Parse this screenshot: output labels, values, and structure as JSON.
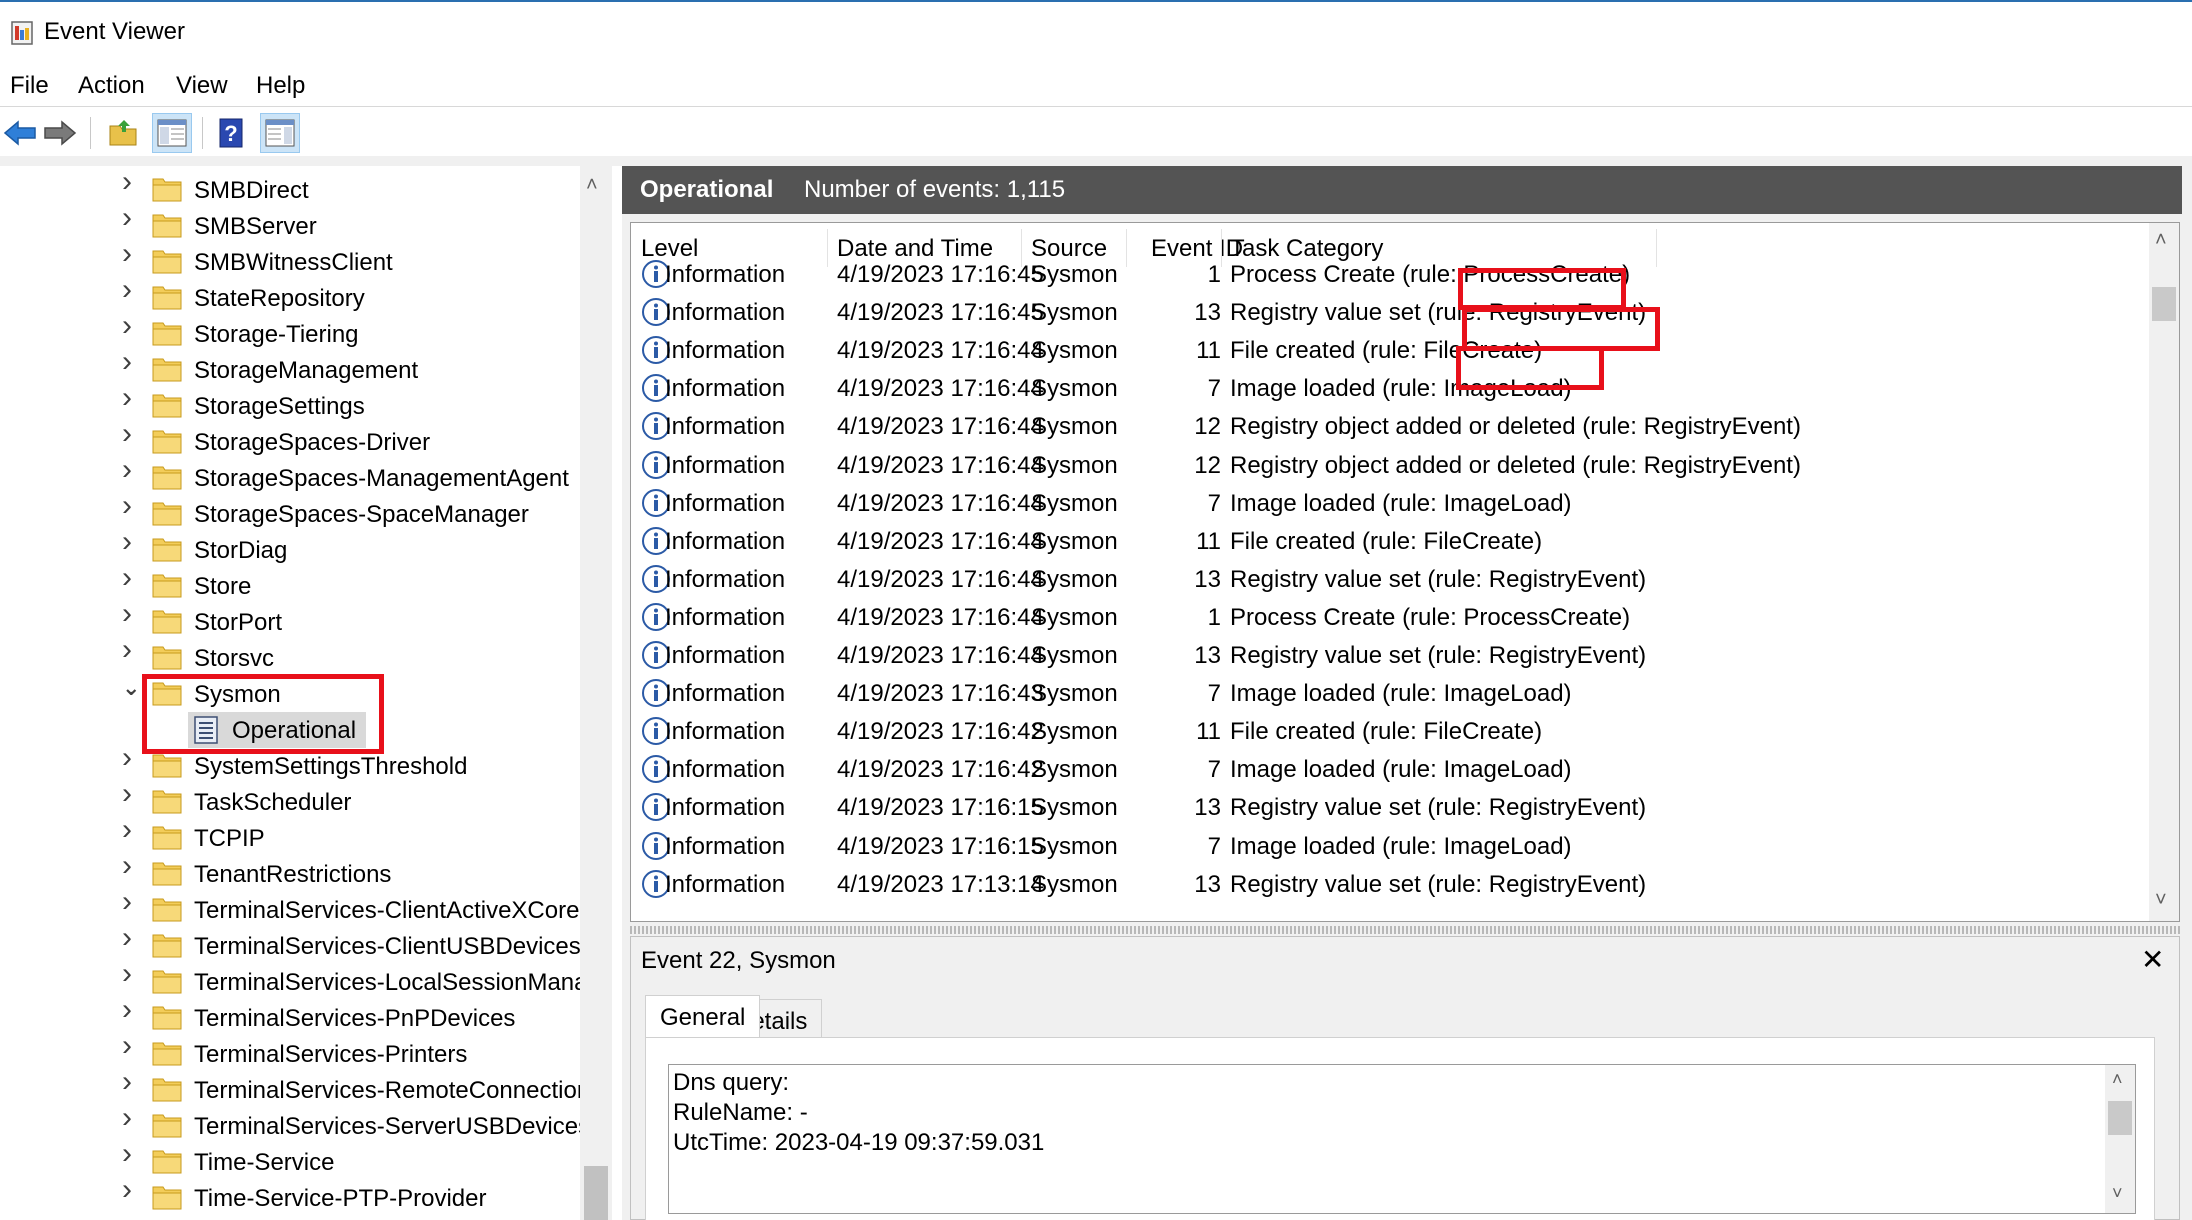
{
  "window": {
    "title": "Event Viewer"
  },
  "menu": [
    "File",
    "Action",
    "View",
    "Help"
  ],
  "toolbar": {
    "icons": [
      "back-arrow-icon",
      "forward-arrow-icon",
      "open-folder-icon",
      "show-hide-console-tree-icon",
      "help-icon",
      "show-hide-action-pane-icon"
    ]
  },
  "tree": {
    "items": [
      {
        "label": "SMBDirect",
        "expanded": false
      },
      {
        "label": "SMBServer",
        "expanded": false
      },
      {
        "label": "SMBWitnessClient",
        "expanded": false
      },
      {
        "label": "StateRepository",
        "expanded": false
      },
      {
        "label": "Storage-Tiering",
        "expanded": false
      },
      {
        "label": "StorageManagement",
        "expanded": false
      },
      {
        "label": "StorageSettings",
        "expanded": false
      },
      {
        "label": "StorageSpaces-Driver",
        "expanded": false
      },
      {
        "label": "StorageSpaces-ManagementAgent",
        "expanded": false
      },
      {
        "label": "StorageSpaces-SpaceManager",
        "expanded": false
      },
      {
        "label": "StorDiag",
        "expanded": false
      },
      {
        "label": "Store",
        "expanded": false
      },
      {
        "label": "StorPort",
        "expanded": false
      },
      {
        "label": "Storsvc",
        "expanded": false
      },
      {
        "label": "Sysmon",
        "expanded": true
      },
      {
        "label": "Operational",
        "child": true,
        "selected": true
      },
      {
        "label": "SystemSettingsThreshold",
        "expanded": false
      },
      {
        "label": "TaskScheduler",
        "expanded": false
      },
      {
        "label": "TCPIP",
        "expanded": false
      },
      {
        "label": "TenantRestrictions",
        "expanded": false
      },
      {
        "label": "TerminalServices-ClientActiveXCore",
        "expanded": false
      },
      {
        "label": "TerminalServices-ClientUSBDevices",
        "expanded": false
      },
      {
        "label": "TerminalServices-LocalSessionManag",
        "expanded": false
      },
      {
        "label": "TerminalServices-PnPDevices",
        "expanded": false
      },
      {
        "label": "TerminalServices-Printers",
        "expanded": false
      },
      {
        "label": "TerminalServices-RemoteConnectionI",
        "expanded": false
      },
      {
        "label": "TerminalServices-ServerUSBDevices",
        "expanded": false
      },
      {
        "label": "Time-Service",
        "expanded": false
      },
      {
        "label": "Time-Service-PTP-Provider",
        "expanded": false
      }
    ]
  },
  "log": {
    "title": "Operational",
    "count_text": "Number of events: 1,115",
    "columns": [
      "Level",
      "Date and Time",
      "Source",
      "Event ID",
      "Task Category"
    ],
    "rows": [
      [
        "Information",
        "4/19/2023 17:16:45",
        "Sysmon",
        "1",
        "Process Create (rule: ProcessCreate)"
      ],
      [
        "Information",
        "4/19/2023 17:16:45",
        "Sysmon",
        "13",
        "Registry value set (rule: RegistryEvent)"
      ],
      [
        "Information",
        "4/19/2023 17:16:44",
        "Sysmon",
        "11",
        "File created (rule: FileCreate)"
      ],
      [
        "Information",
        "4/19/2023 17:16:44",
        "Sysmon",
        "7",
        "Image loaded (rule: ImageLoad)"
      ],
      [
        "Information",
        "4/19/2023 17:16:44",
        "Sysmon",
        "12",
        "Registry object added or deleted (rule: RegistryEvent)"
      ],
      [
        "Information",
        "4/19/2023 17:16:44",
        "Sysmon",
        "12",
        "Registry object added or deleted (rule: RegistryEvent)"
      ],
      [
        "Information",
        "4/19/2023 17:16:44",
        "Sysmon",
        "7",
        "Image loaded (rule: ImageLoad)"
      ],
      [
        "Information",
        "4/19/2023 17:16:44",
        "Sysmon",
        "11",
        "File created (rule: FileCreate)"
      ],
      [
        "Information",
        "4/19/2023 17:16:44",
        "Sysmon",
        "13",
        "Registry value set (rule: RegistryEvent)"
      ],
      [
        "Information",
        "4/19/2023 17:16:44",
        "Sysmon",
        "1",
        "Process Create (rule: ProcessCreate)"
      ],
      [
        "Information",
        "4/19/2023 17:16:44",
        "Sysmon",
        "13",
        "Registry value set (rule: RegistryEvent)"
      ],
      [
        "Information",
        "4/19/2023 17:16:43",
        "Sysmon",
        "7",
        "Image loaded (rule: ImageLoad)"
      ],
      [
        "Information",
        "4/19/2023 17:16:42",
        "Sysmon",
        "11",
        "File created (rule: FileCreate)"
      ],
      [
        "Information",
        "4/19/2023 17:16:42",
        "Sysmon",
        "7",
        "Image loaded (rule: ImageLoad)"
      ],
      [
        "Information",
        "4/19/2023 17:16:15",
        "Sysmon",
        "13",
        "Registry value set (rule: RegistryEvent)"
      ],
      [
        "Information",
        "4/19/2023 17:16:15",
        "Sysmon",
        "7",
        "Image loaded (rule: ImageLoad)"
      ],
      [
        "Information",
        "4/19/2023 17:13:14",
        "Sysmon",
        "13",
        "Registry value set (rule: RegistryEvent)"
      ]
    ]
  },
  "detail": {
    "title": "Event 22, Sysmon",
    "close": "✕",
    "tabs": [
      "General",
      "Details"
    ],
    "lines": [
      "Dns query:",
      "RuleName: -",
      "UtcTime: 2023-04-19 09:37:59.031"
    ]
  },
  "colors": {
    "highlight_box": "#e8101a",
    "header_bg": "#545454",
    "selected_bg": "#d9d9d9"
  }
}
